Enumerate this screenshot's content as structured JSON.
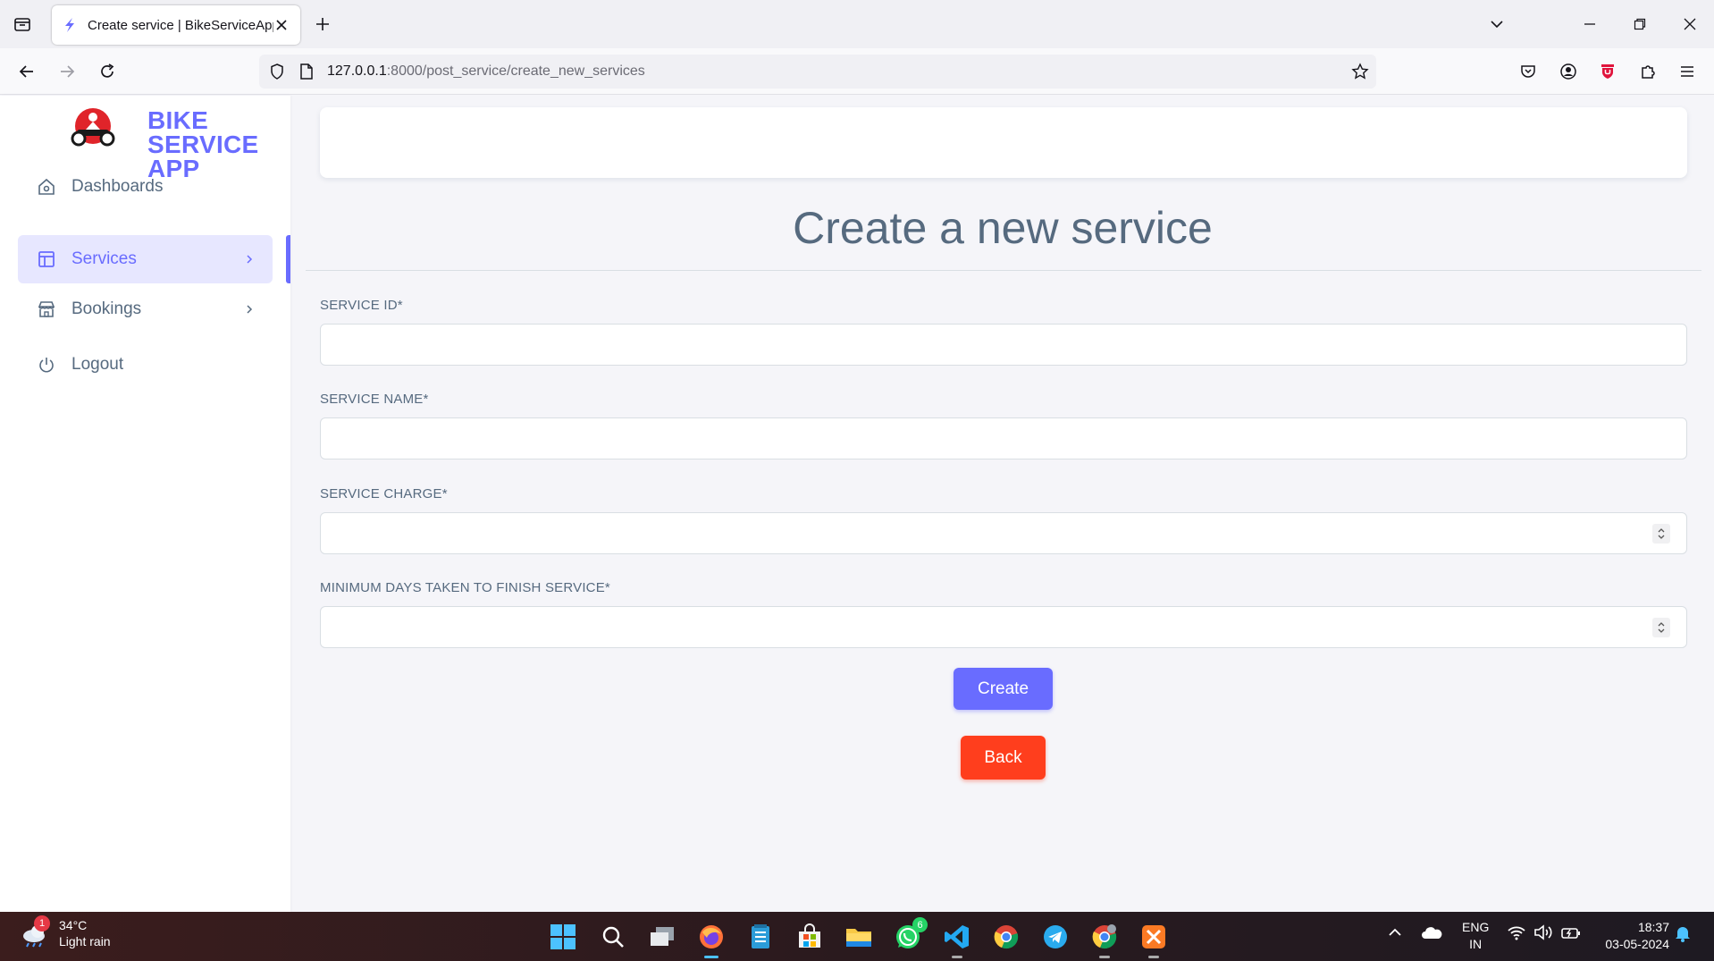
{
  "browser": {
    "tab_title": "Create service | BikeServiceApp",
    "url_host": "127.0.0.1",
    "url_rest": ":8000/post_service/create_new_services"
  },
  "sidebar": {
    "brand_line1": "BIKE",
    "brand_line2": "SERVICE",
    "brand_line3": "APP",
    "items": [
      {
        "label": "Dashboards",
        "icon": "home-icon"
      },
      {
        "label": "Services",
        "icon": "layout-icon",
        "active": true
      },
      {
        "label": "Bookings",
        "icon": "store-icon"
      },
      {
        "label": "Logout",
        "icon": "power-icon"
      }
    ]
  },
  "main": {
    "title": "Create a new service",
    "fields": [
      {
        "label": "SERVICE ID*",
        "value": ""
      },
      {
        "label": "SERVICE NAME*",
        "value": ""
      },
      {
        "label": "SERVICE CHARGE*",
        "value": ""
      },
      {
        "label": "MINIMUM DAYS TAKEN TO FINISH SERVICE*",
        "value": ""
      }
    ],
    "create_label": "Create",
    "back_label": "Back"
  },
  "colors": {
    "accent": "#696cff",
    "danger": "#ff3e1d",
    "text": "#566a7f"
  },
  "taskbar": {
    "weather_temp": "34°C",
    "weather_desc": "Light rain",
    "weather_badge": "1",
    "whatsapp_badge": "6",
    "lang_line1": "ENG",
    "lang_line2": "IN",
    "time": "18:37",
    "date": "03-05-2024"
  }
}
